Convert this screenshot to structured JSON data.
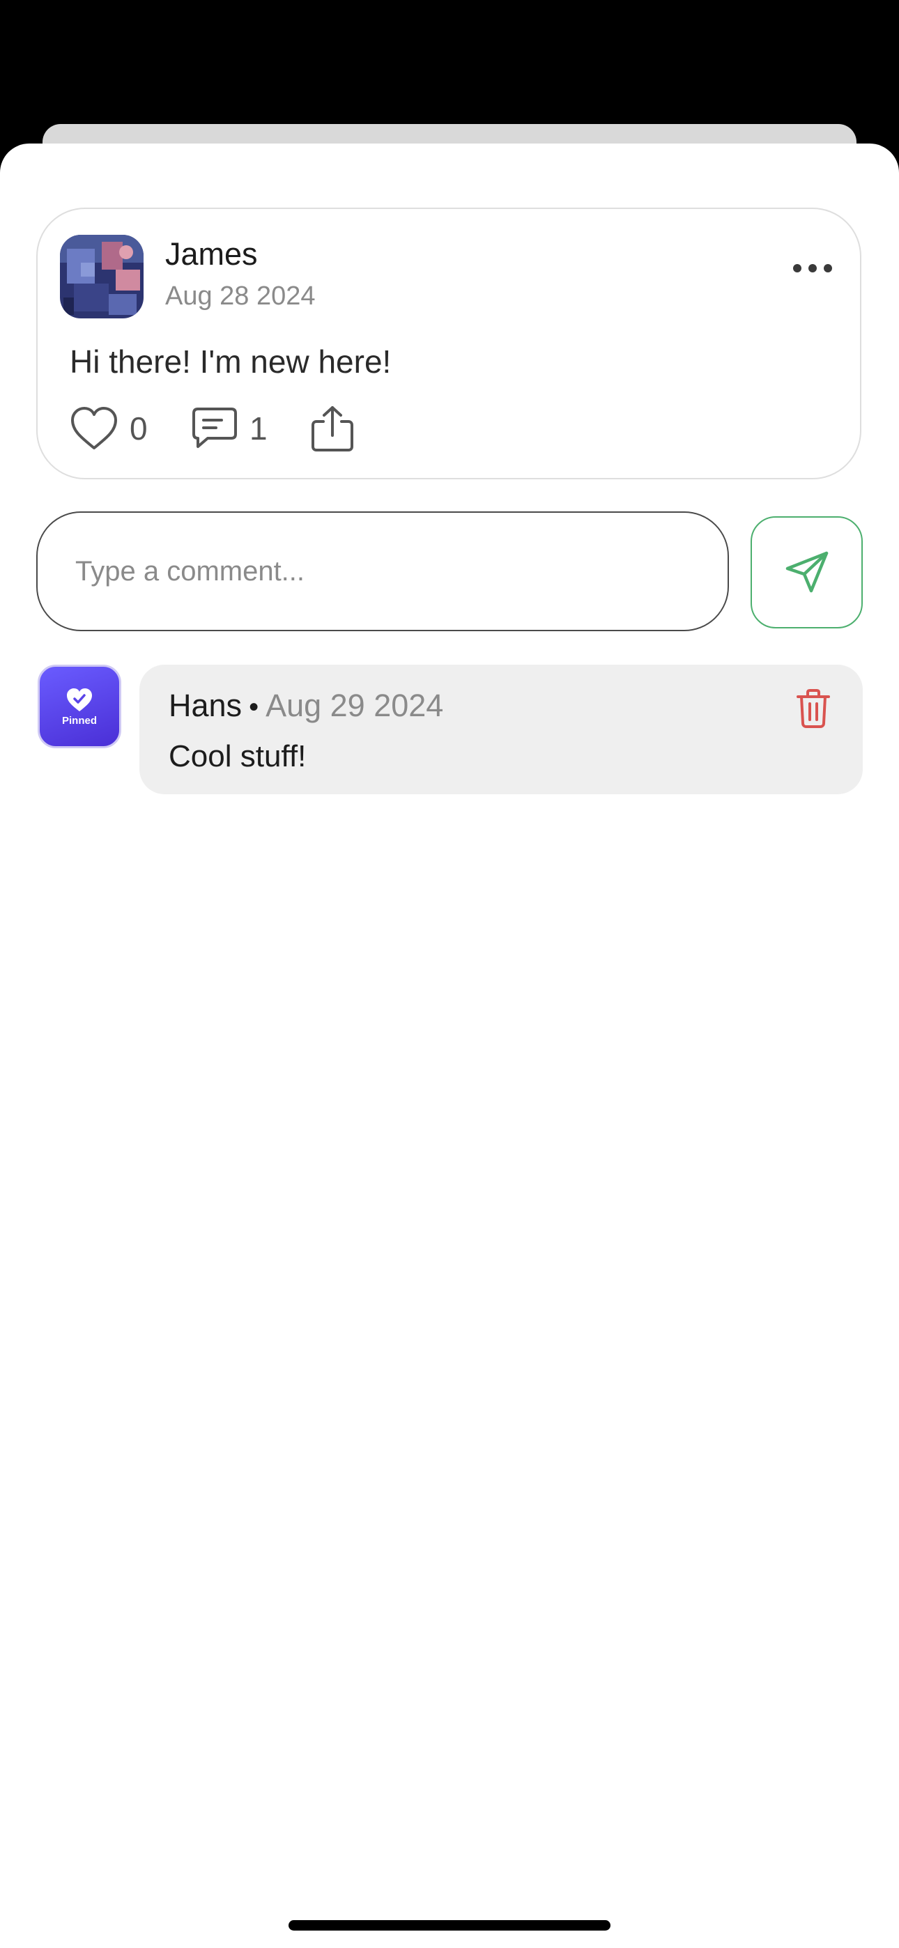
{
  "post": {
    "author": "James",
    "date": "Aug 28 2024",
    "body": "Hi there! I'm new here!",
    "likes": "0",
    "comments": "1",
    "avatar_icon": "profile-photo"
  },
  "comment_box": {
    "placeholder": "Type a comment...",
    "value": "",
    "send_icon": "send-icon"
  },
  "comments": [
    {
      "name": "Hans",
      "separator": "•",
      "date": "Aug 29 2024",
      "text": "Cool stuff!",
      "avatar_label": "Pinned",
      "avatar_icon": "heart-check-icon",
      "delete_icon": "trash-icon"
    }
  ],
  "colors": {
    "send_accent": "#4caf6e",
    "delete_accent": "#d9534f",
    "pinned_gradient_start": "#6a5cff",
    "pinned_gradient_end": "#4a2fd6",
    "comment_bubble": "#efefef"
  }
}
